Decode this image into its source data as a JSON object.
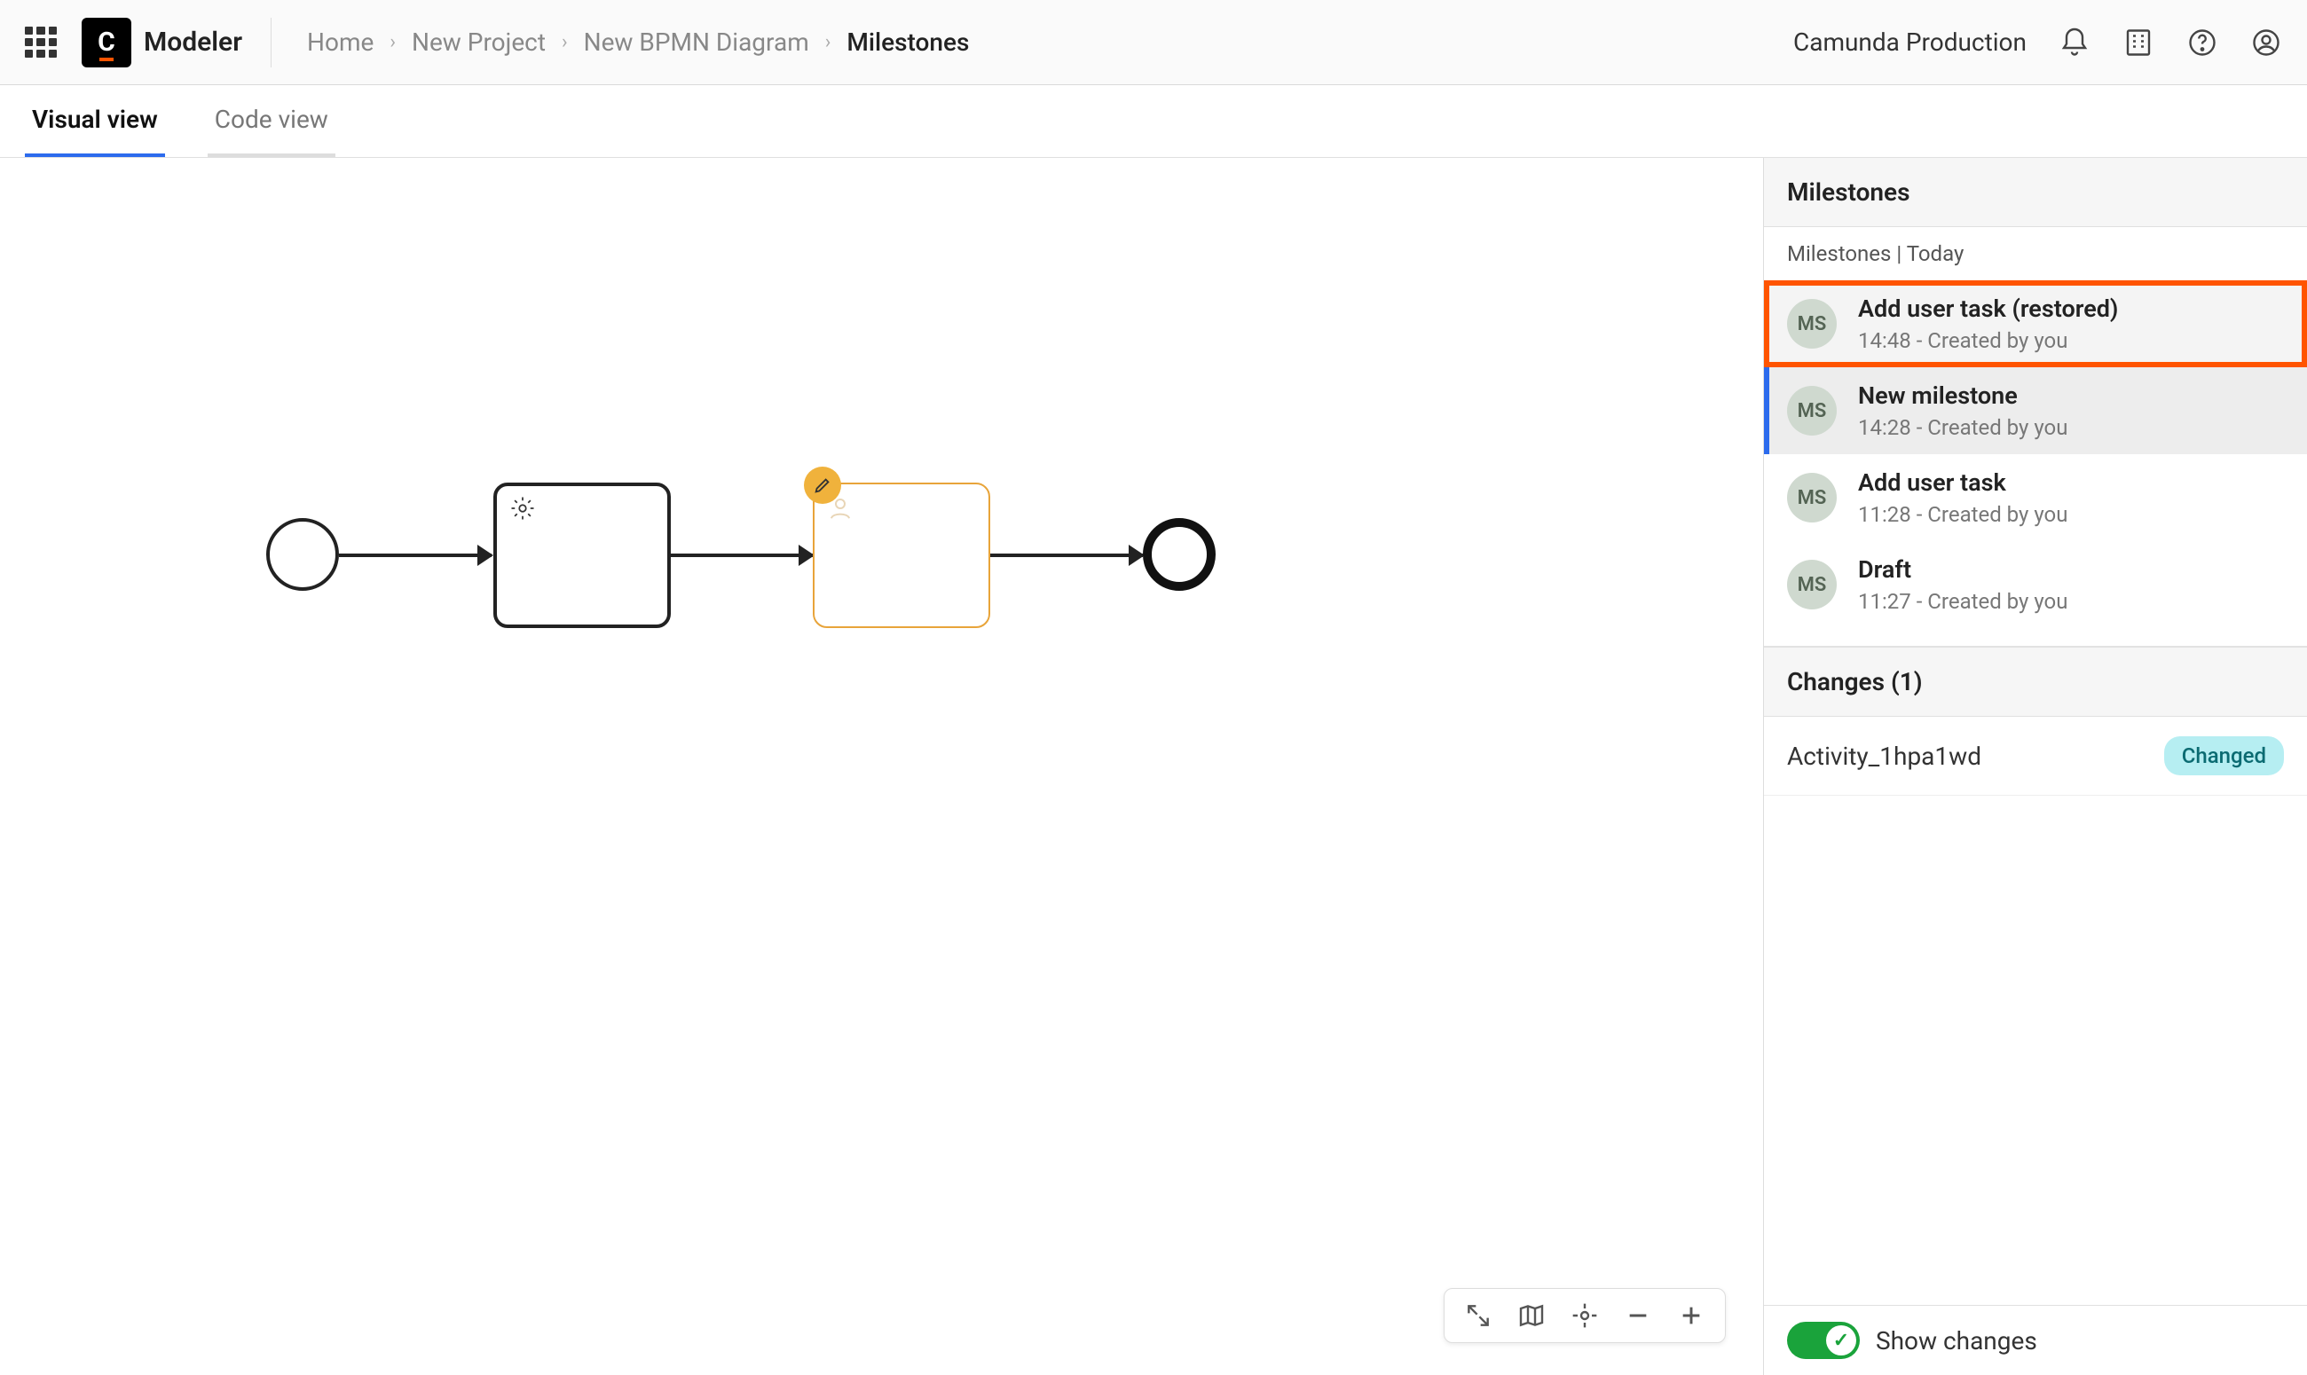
{
  "header": {
    "brand": "Modeler",
    "brand_glyph": "C",
    "breadcrumbs": [
      "Home",
      "New Project",
      "New BPMN Diagram",
      "Milestones"
    ],
    "org": "Camunda Production"
  },
  "tabs": {
    "visual": "Visual view",
    "code": "Code view"
  },
  "panel": {
    "title": "Milestones",
    "group_label": "Milestones | Today",
    "items": [
      {
        "avatar": "MS",
        "title": "Add user task (restored)",
        "sub": "14:48 - Created by you",
        "highlighted": true
      },
      {
        "avatar": "MS",
        "title": "New milestone",
        "sub": "14:28 - Created by you",
        "selected": true
      },
      {
        "avatar": "MS",
        "title": "Add user task",
        "sub": "11:28 - Created by you"
      },
      {
        "avatar": "MS",
        "title": "Draft",
        "sub": "11:27 - Created by you"
      }
    ],
    "changes_title": "Changes (1)",
    "change_item": "Activity_1hpa1wd",
    "change_badge": "Changed",
    "footer_label": "Show changes"
  }
}
